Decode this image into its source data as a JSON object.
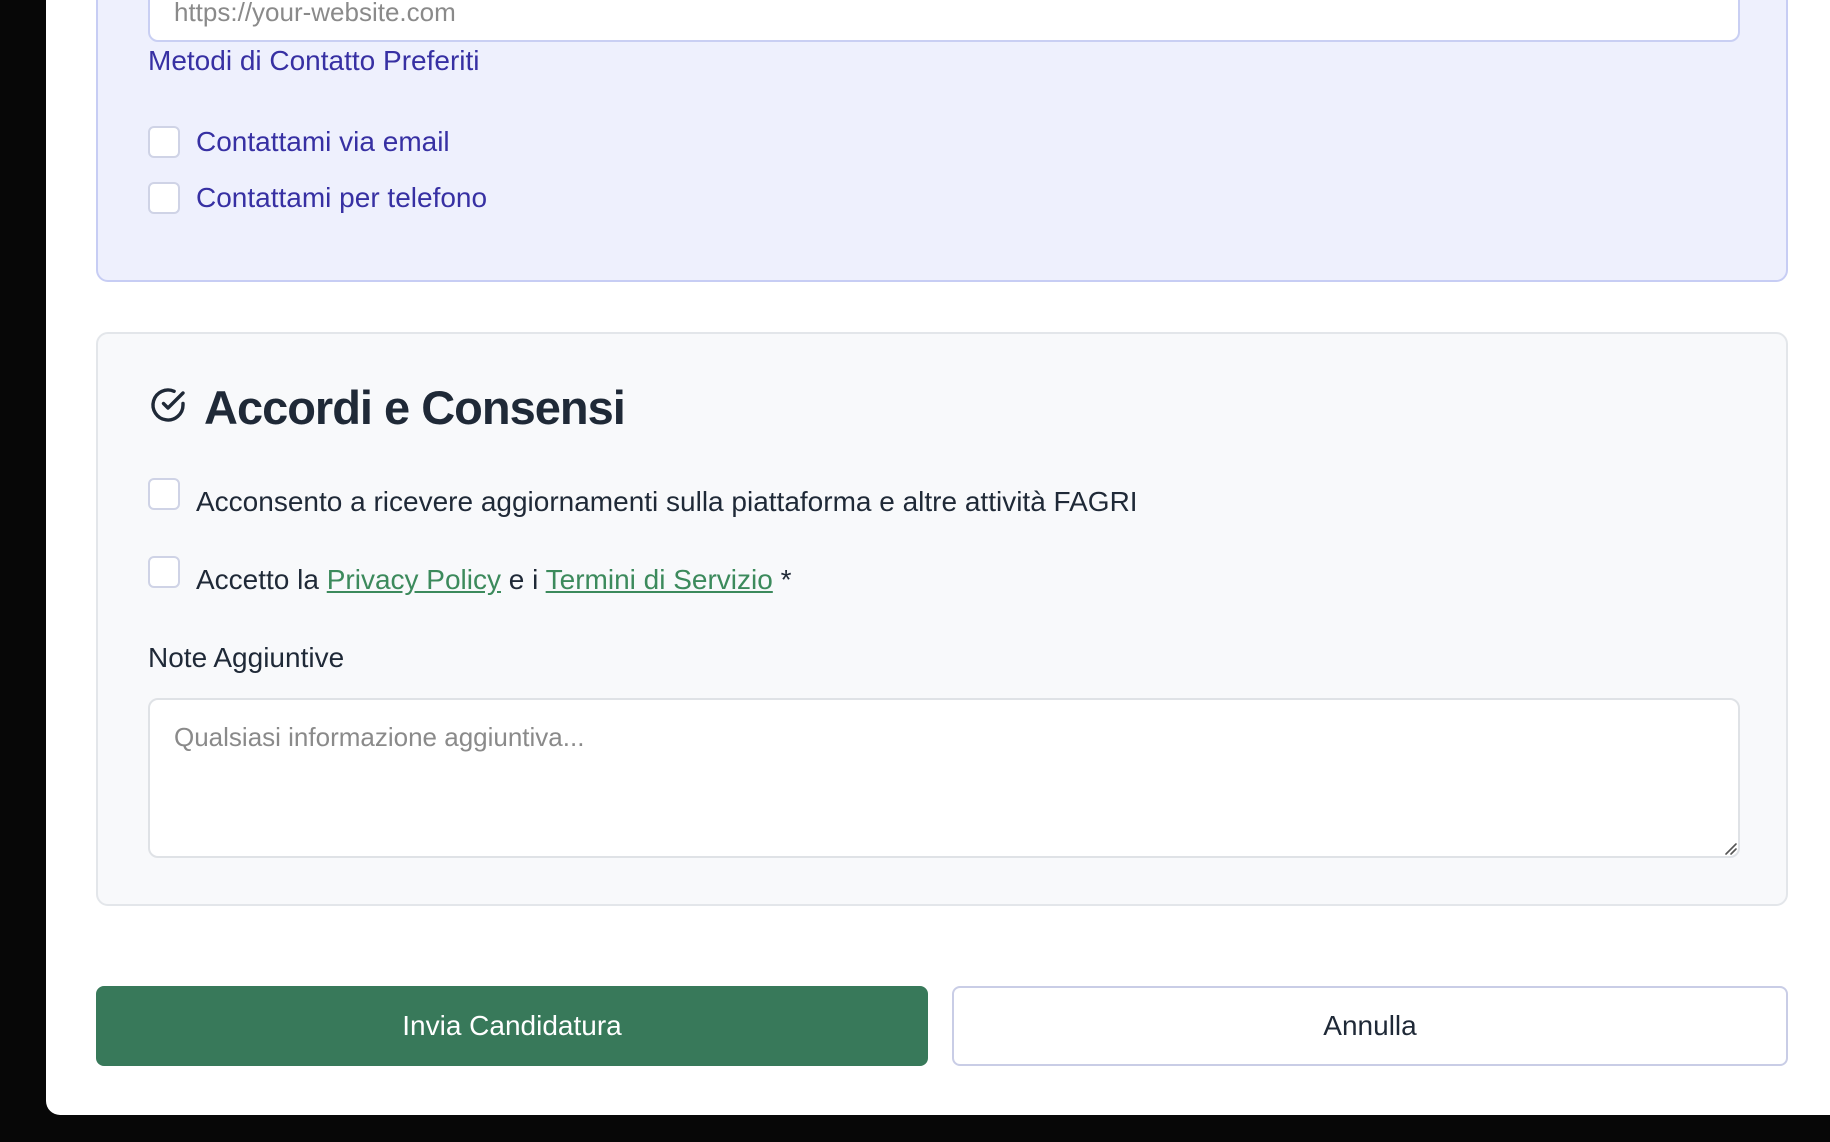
{
  "contact": {
    "website_placeholder": "https://your-website.com",
    "preferred_methods_title": "Metodi di Contatto Preferiti",
    "options": [
      {
        "label": "Contattami via email",
        "checked": false
      },
      {
        "label": "Contattami per telefono",
        "checked": false
      }
    ]
  },
  "consents": {
    "icon": "check-circle-icon",
    "title": "Accordi e Consensi",
    "updates_label": "Acconsento a ricevere aggiornamenti sulla piattaforma e altre attività FAGRI",
    "accept_prefix": "Accetto la",
    "privacy_link": "Privacy Policy",
    "and_text": "e i",
    "terms_link": "Termini di Servizio",
    "required_mark": "*",
    "notes_label": "Note Aggiuntive",
    "notes_placeholder": "Qualsiasi informazione aggiuntiva..."
  },
  "actions": {
    "submit_label": "Invia Candidatura",
    "cancel_label": "Annulla"
  },
  "colors": {
    "accent_indigo": "#3730a3",
    "primary_green": "#38795a",
    "link_green": "#3c8a5c"
  }
}
